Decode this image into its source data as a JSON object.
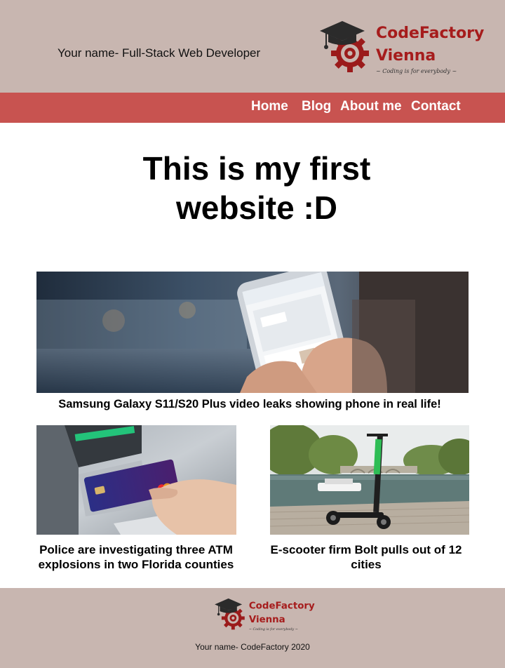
{
  "header": {
    "name": "Your name- Full-Stack Web Developer",
    "logo": {
      "line1": "CodeFactory",
      "line2": "Vienna",
      "tagline": "~ Coding is for everybody ~"
    }
  },
  "nav": {
    "items": [
      {
        "label": "Home"
      },
      {
        "label": "Blog"
      },
      {
        "label": "About me"
      },
      {
        "label": "Contact"
      }
    ]
  },
  "hero": {
    "title": "This is my first website :D"
  },
  "articles": [
    {
      "caption": "Samsung Galaxy S11/S20 Plus video leaks showing phone in real life!",
      "image_icon": "phone-map-photo"
    },
    {
      "caption": "Police are investigating three ATM explosions in two Florida counties",
      "image_icon": "atm-card-photo"
    },
    {
      "caption": "E-scooter firm Bolt pulls out of 12 cities",
      "image_icon": "scooter-river-photo"
    }
  ],
  "footer": {
    "text": "Your name- CodeFactory 2020",
    "logo": {
      "line1": "CodeFactory",
      "line2": "Vienna",
      "tagline": "~ Coding is for everybody ~"
    }
  },
  "colors": {
    "header_bg": "#c8b6b0",
    "nav_bg": "#c85350",
    "brand": "#a61c1c"
  }
}
